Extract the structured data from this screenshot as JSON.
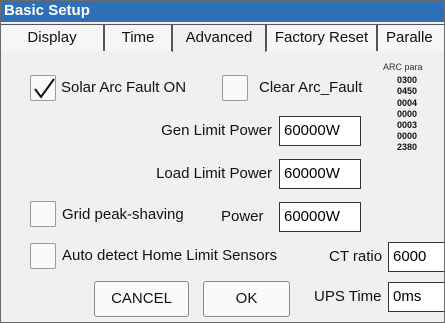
{
  "window": {
    "title": "Basic Setup"
  },
  "tabs": [
    "Display",
    "Time",
    "Advanced",
    "Factory Reset",
    "Paralle"
  ],
  "active_tab": "Advanced",
  "checkboxes": {
    "solar_arc_fault": {
      "label": "Solar Arc Fault ON",
      "checked": true
    },
    "clear_arc_fault": {
      "label": "Clear Arc_Fault",
      "checked": false
    },
    "grid_peak_shaving": {
      "label": "Grid peak-shaving",
      "checked": false
    },
    "auto_detect": {
      "label": "Auto detect Home Limit Sensors",
      "checked": false
    }
  },
  "fields": {
    "gen_limit_power": {
      "label": "Gen Limit Power",
      "value": "60000W"
    },
    "load_limit_power": {
      "label": "Load Limit Power",
      "value": "60000W"
    },
    "grid_peak_power": {
      "label": "Power",
      "value": "60000W"
    },
    "ct_ratio": {
      "label": "CT ratio",
      "value": "6000"
    },
    "ups_time": {
      "label": "UPS Time",
      "value": "0ms"
    }
  },
  "arc_params": {
    "title": "ARC para",
    "values": [
      "0300",
      "0450",
      "0004",
      "0000",
      "0003",
      "0000",
      "2380"
    ]
  },
  "buttons": {
    "cancel": "CANCEL",
    "ok": "OK"
  }
}
